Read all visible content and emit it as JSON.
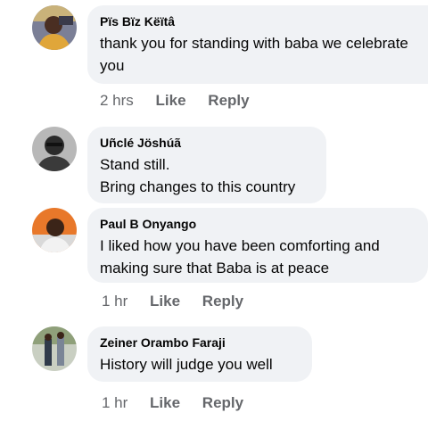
{
  "comments": [
    {
      "author": "Pïs Bïz Këïtâ",
      "lines": [
        "thank you for standing with baba we celebrate",
        "you"
      ],
      "time": "2 hrs",
      "like": "Like",
      "reply": "Reply"
    },
    {
      "author": "Uñclé Jöshúã",
      "lines": [
        "Stand still.",
        "Bring changes to this country"
      ]
    },
    {
      "author": "Paul B Onyango",
      "lines": [
        "I liked how you have been comforting and",
        "making sure that Baba is at peace"
      ],
      "time": "1 hr",
      "like": "Like",
      "reply": "Reply"
    },
    {
      "author": "Zeiner Orambo Faraji",
      "lines": [
        "History will judge you well"
      ],
      "time": "1 hr",
      "like": "Like",
      "reply": "Reply"
    }
  ]
}
